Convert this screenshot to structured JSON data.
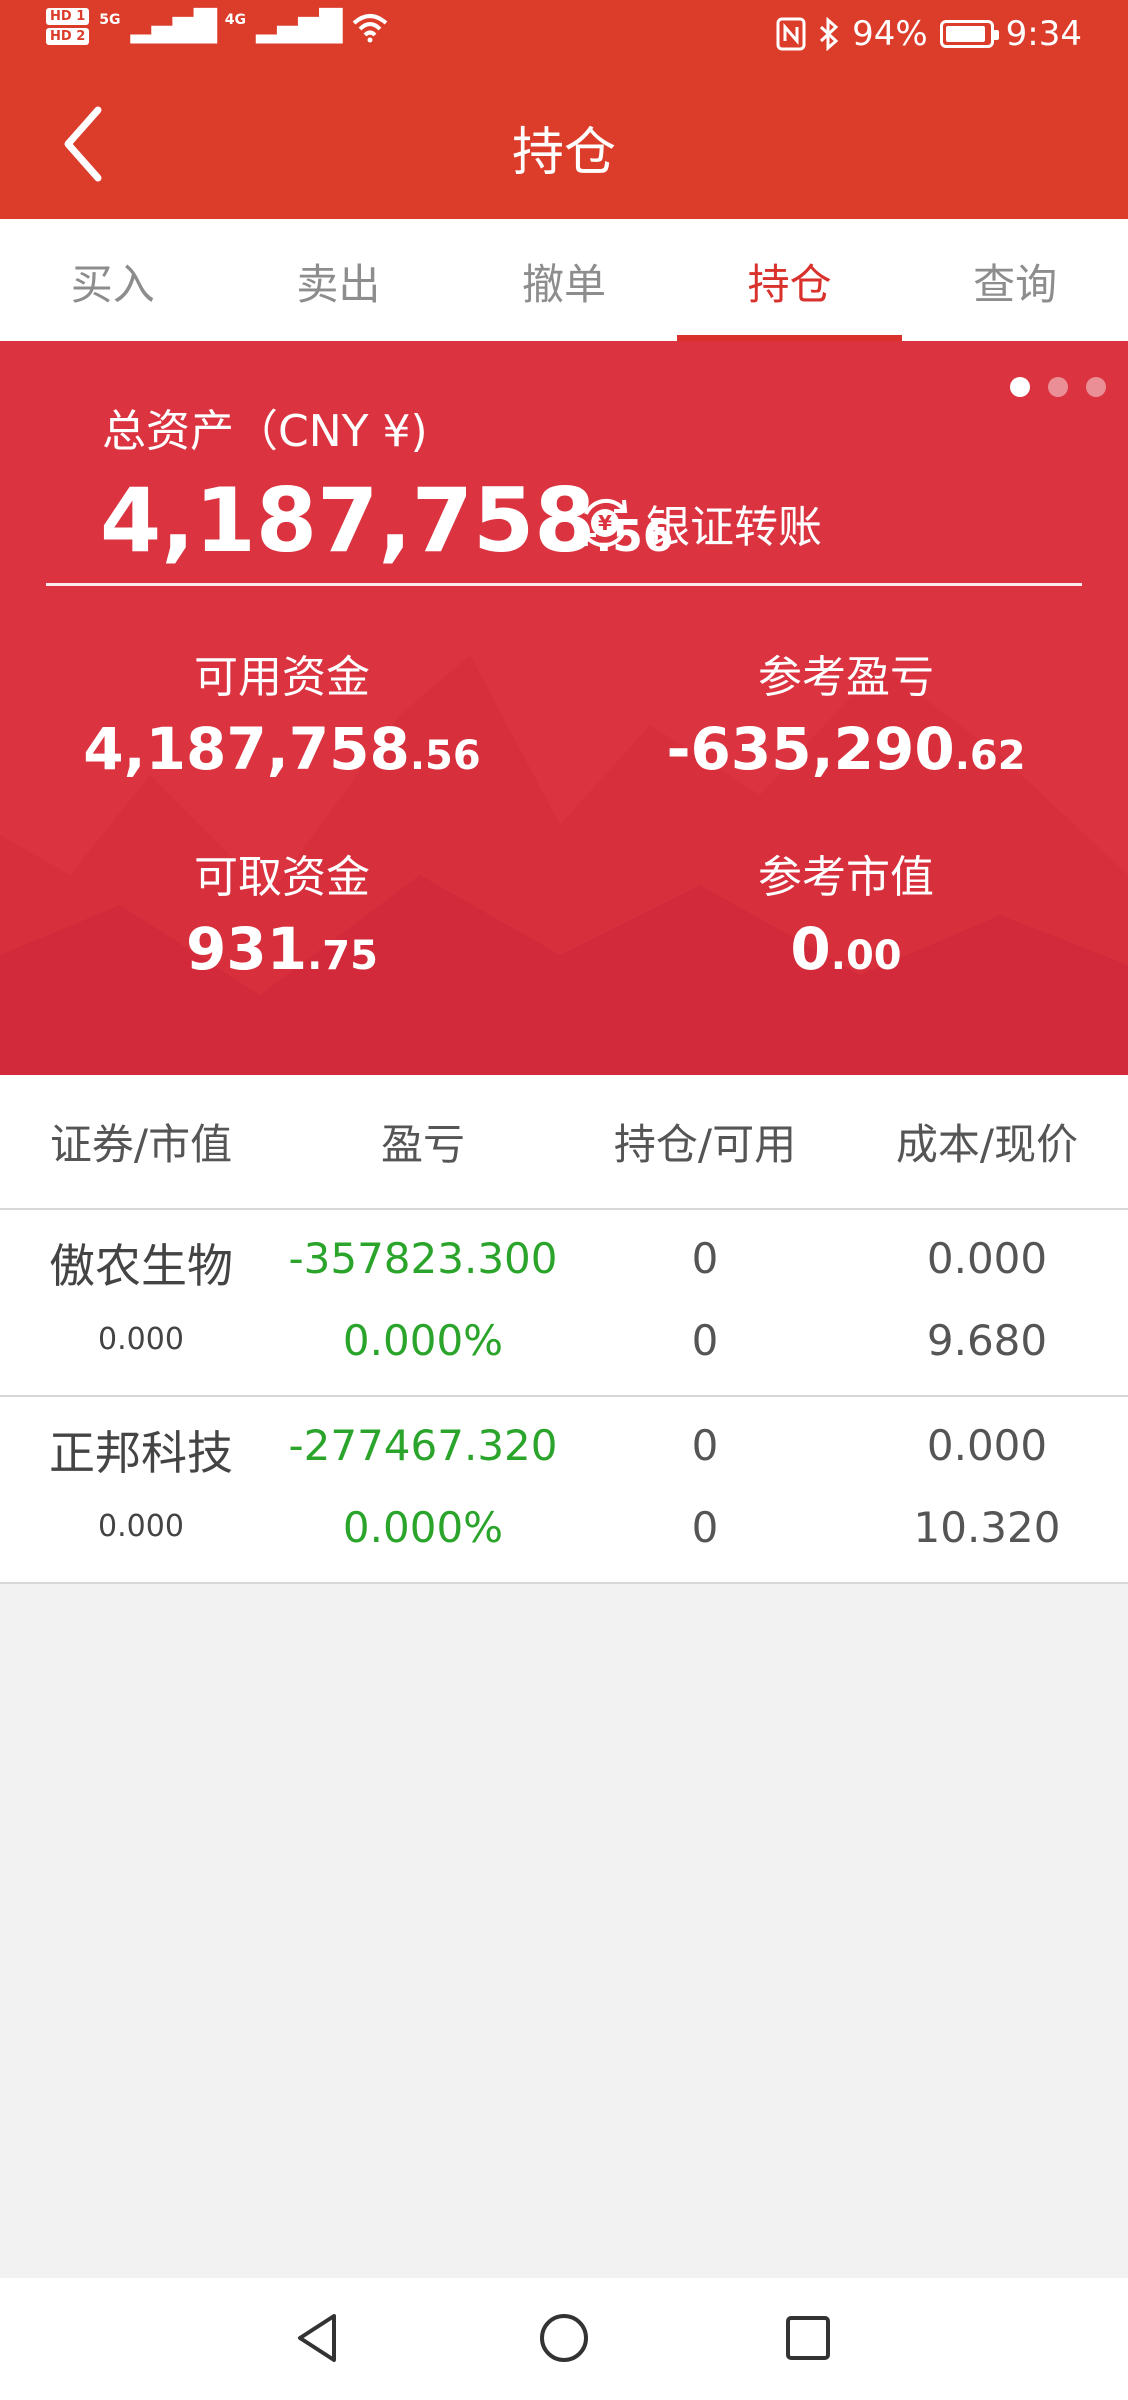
{
  "status_bar": {
    "hd1": "HD 1",
    "hd2": "HD 2",
    "sig1": "5G",
    "sig2": "4G",
    "battery": "94%",
    "time": "9:34",
    "battery_level": 0.94
  },
  "header": {
    "title": "持仓"
  },
  "tabs": [
    {
      "label": "买入"
    },
    {
      "label": "卖出"
    },
    {
      "label": "撤单"
    },
    {
      "label": "持仓",
      "active": true
    },
    {
      "label": "查询"
    }
  ],
  "assets": {
    "total_label": "总资产（CNY ¥)",
    "total_int": "4,187,758",
    "total_dec": ".56",
    "transfer_label": "银证转账",
    "available_label": "可用资金",
    "available_int": "4,187,758",
    "available_dec": ".56",
    "pnl_label": "参考盈亏",
    "pnl_int": "-635,290",
    "pnl_dec": ".62",
    "withdrawable_label": "可取资金",
    "withdrawable_int": "931",
    "withdrawable_dec": ".75",
    "market_value_label": "参考市值",
    "market_value_int": "0",
    "market_value_dec": ".00"
  },
  "table": {
    "headers": [
      "证券/市值",
      "盈亏",
      "持仓/可用",
      "成本/现价"
    ],
    "rows": [
      {
        "name": "傲农生物",
        "market_value": "0.000",
        "pnl": "-357823.300",
        "pnl_pct": "0.000%",
        "position": "0",
        "available": "0",
        "cost": "0.000",
        "price": "9.680"
      },
      {
        "name": "正邦科技",
        "market_value": "0.000",
        "pnl": "-277467.320",
        "pnl_pct": "0.000%",
        "position": "0",
        "available": "0",
        "cost": "0.000",
        "price": "10.320"
      }
    ]
  },
  "colors": {
    "header_red": "#dc3c2a",
    "panel_red": "#db3340",
    "tab_active": "#d9312b",
    "loss_green": "#2aa42a"
  }
}
